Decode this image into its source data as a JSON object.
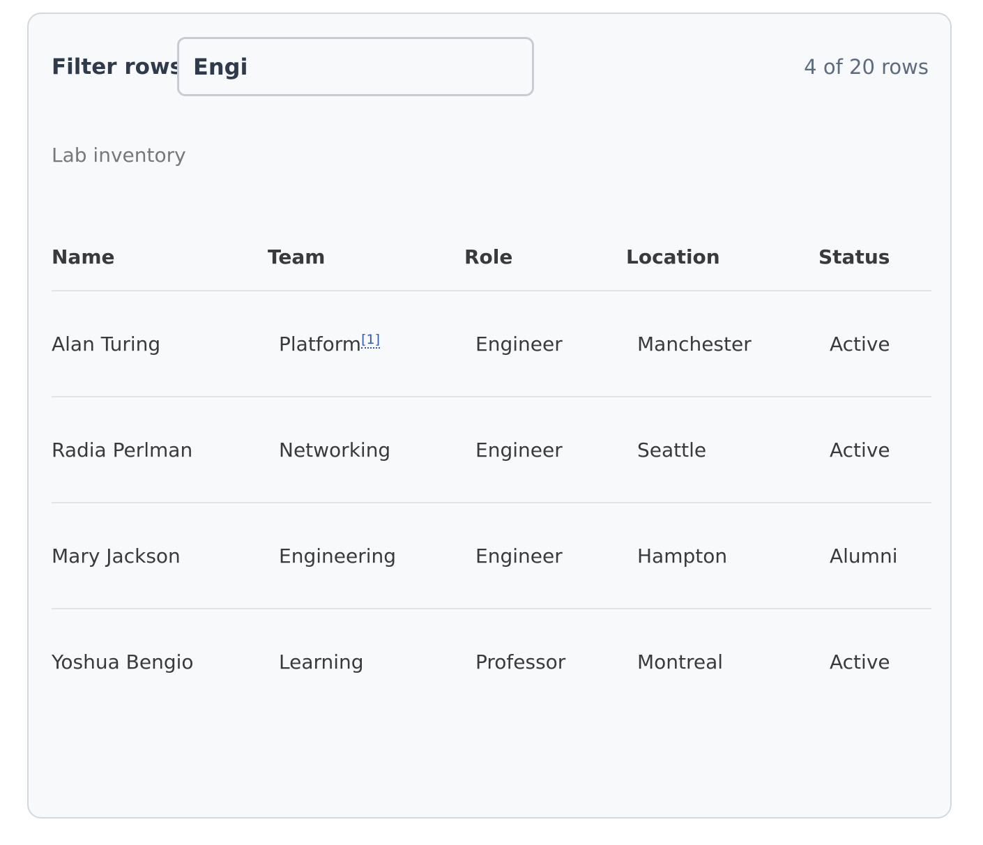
{
  "filter": {
    "label": "Filter rows",
    "value": "Engi",
    "count_text": "4 of 20 rows"
  },
  "table": {
    "caption": "Lab inventory",
    "headers": [
      "Name",
      "Team",
      "Role",
      "Location",
      "Status"
    ],
    "rows": [
      {
        "name": "Alan Turing",
        "team": "Platform",
        "team_footnote": "[1]",
        "role": "Engineer",
        "location": "Manchester",
        "status": "Active"
      },
      {
        "name": "Radia Perlman",
        "team": "Networking",
        "role": "Engineer",
        "location": "Seattle",
        "status": "Active"
      },
      {
        "name": "Mary Jackson",
        "team": "Engineering",
        "role": "Engineer",
        "location": "Hampton",
        "status": "Alumni"
      },
      {
        "name": "Yoshua Bengio",
        "team": "Learning",
        "role": "Professor",
        "location": "Montreal",
        "status": "Active"
      }
    ]
  },
  "colors": {
    "card_background": "#f8f9fb",
    "card_border": "#d3d8e0",
    "footnote_link": "#2f56c8"
  }
}
